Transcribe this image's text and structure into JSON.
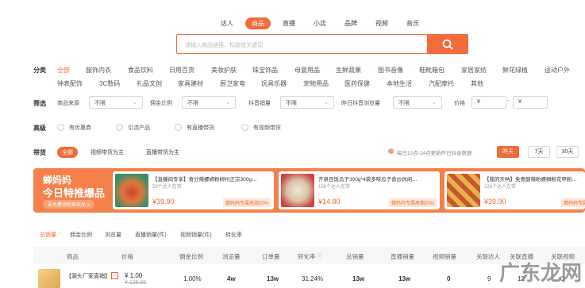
{
  "top_nav": [
    "达人",
    "商品",
    "直播",
    "小店",
    "品牌",
    "视频",
    "音乐"
  ],
  "top_nav_active": "商品",
  "search": {
    "placeholder": "请输入商品链接、标题或关键词"
  },
  "category": {
    "label": "分类",
    "row1": [
      "全部",
      "服饰内衣",
      "食品饮料",
      "日用百货",
      "美妆护肤",
      "珠宝饰品",
      "母婴用品",
      "生鲜蔬果",
      "图书音像",
      "鞋靴箱包",
      "家居家纺",
      "鲜花绿植",
      "运动户外"
    ],
    "row2": [
      "钟表配饰",
      "3C数码",
      "礼品文创",
      "家具建材",
      "厨卫家电",
      "玩具乐器",
      "宠物用品",
      "医药保健",
      "本地生活",
      "汽配摩托",
      "其他"
    ],
    "active": "全部"
  },
  "filters": {
    "label": "筛选",
    "source_label": "商品来源",
    "source_value": "不限",
    "commission_label": "佣金比例",
    "commission_value": "不限",
    "douyin_sales_label": "抖音销量",
    "douyin_sales_value": "不限",
    "yesterday_views_label": "昨日抖音浏览量",
    "yesterday_views_value": "不限",
    "price_label": "价格",
    "price_from": "¥",
    "price_sep": "-",
    "price_to": "¥"
  },
  "advanced": {
    "label": "高级",
    "options": [
      "有优惠券",
      "引流产品",
      "有直播带货",
      "有视频带货"
    ]
  },
  "goods": {
    "label": "带货",
    "tags": [
      "全部",
      "视频带货为主",
      "直播带货为主"
    ],
    "active": "全部",
    "update_note": "每日12点-14点更新昨日抖音数据",
    "days": [
      "昨天",
      "7天",
      "30天"
    ],
    "days_active": "昨天"
  },
  "banner": {
    "title1": "蝉妈妈",
    "title2": "今日特推爆品",
    "sub": "去免费领取推样品 >",
    "cards": [
      {
        "title": "【直播间专享】食分辣螺蛳粉柳州正宗300g…",
        "sub": "53个达人在带",
        "price": "¥39.90",
        "badge": "蝉妈妈专属高佣20%"
      },
      {
        "title": "齐泉百饭瓜子300g*4袋多味瓜子香炒休闲…",
        "sub": "156个达人在带",
        "price": "¥14.80",
        "badge": "蝉妈妈专属高佣20%"
      },
      {
        "title": "【我的天呐】免煮酸辣粉螺蛳粉花甲粉…",
        "sub": "226个达人在带",
        "price": "¥39.90",
        "badge": "蝉妈妈专属高佣20%"
      }
    ]
  },
  "sort_tabs": [
    "总销量",
    "佣金比例",
    "浏览量",
    "直播销量(件)",
    "视频销量(件)",
    "转化率"
  ],
  "sort_active": "总销量",
  "table": {
    "headers": [
      "商品",
      "价格",
      "佣金比例",
      "浏览量",
      "订单量",
      "转化率",
      "总销量",
      "直播销量",
      "视频销量",
      "关联达人",
      "关联直播",
      "关联视频"
    ],
    "row": {
      "title": "【源头厂家直销】德蒙精…",
      "price": "¥ 1.00",
      "orig_price": "¥ 129.00",
      "commission": "1.00%",
      "views": "4w",
      "orders": "13w",
      "conversion": "31.24%",
      "total_sales": "13w",
      "live_sales": "13w",
      "video_sales": "0",
      "kol": "9",
      "live": "12",
      "video": "0"
    }
  },
  "watermark": "广东龙网",
  "colors": {
    "accent": "#f26b3a",
    "banner": "#f58049"
  }
}
